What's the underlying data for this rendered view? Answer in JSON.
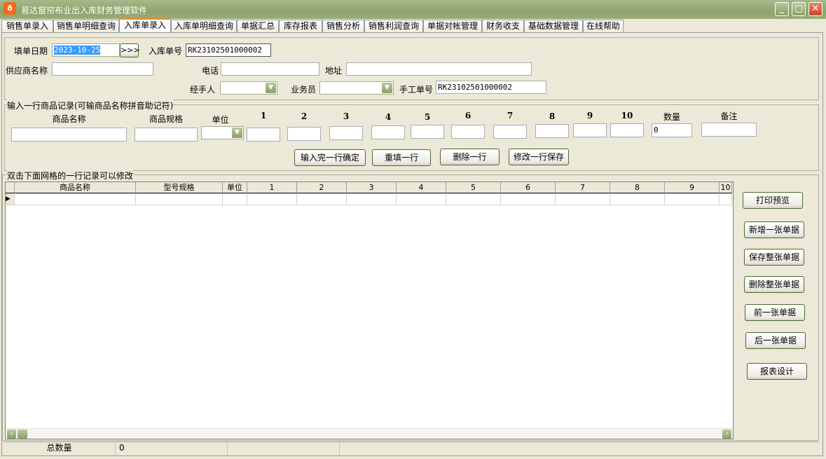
{
  "window": {
    "title": "易达窗帘布业出入库财务管理软件",
    "app_icon": "app-logo-icon",
    "minimize": "_",
    "maximize": "□",
    "close": "✕"
  },
  "tabs": [
    "销售单录入",
    "销售单明细查询",
    "入库单录入",
    "入库单明细查询",
    "单据汇总",
    "库存报表",
    "销售分析",
    "销售利润查询",
    "单据对帐管理",
    "财务收支",
    "基础数据管理",
    "在线帮助"
  ],
  "active_tab": "入库单录入",
  "header": {
    "date_label": "填单日期",
    "date_value": "2023-10-25",
    "date_btn": ">>>",
    "order_no_label": "入库单号",
    "order_no_value": "RK23102501000002",
    "supplier_label": "供应商名称",
    "supplier_value": "",
    "phone_label": "电话",
    "phone_value": "",
    "address_label": "地址",
    "address_value": "",
    "handler_label": "经手人",
    "handler_value": "",
    "salesman_label": "业务员",
    "salesman_value": "",
    "manual_no_label": "手工单号",
    "manual_no_value": "RK23102501000002"
  },
  "entry": {
    "group_title": "输入一行商品记录(可输商品名称拼音助记符)",
    "columns": [
      "商品名称",
      "商品规格",
      "单位",
      "1",
      "2",
      "3",
      "4",
      "5",
      "6",
      "7",
      "8",
      "9",
      "10",
      "数量",
      "备注"
    ],
    "quantity_value": "0",
    "buttons": {
      "confirm": "输入完一行确定",
      "refill": "重填一行",
      "delete": "删除一行",
      "save_edit": "修改一行保存"
    }
  },
  "grid": {
    "group_title": "双击下面网格的一行记录可以修改",
    "columns": [
      "商品名称",
      "型号规格",
      "单位",
      "1",
      "2",
      "3",
      "4",
      "5",
      "6",
      "7",
      "8",
      "9",
      "10"
    ]
  },
  "side_buttons": [
    "打印预览",
    "新增一张单据",
    "保存整张单据",
    "删除整张单据",
    "前一张单据",
    "后一张单据",
    "报表设计"
  ],
  "status": {
    "total_label": "总数量",
    "total_value": "0"
  }
}
